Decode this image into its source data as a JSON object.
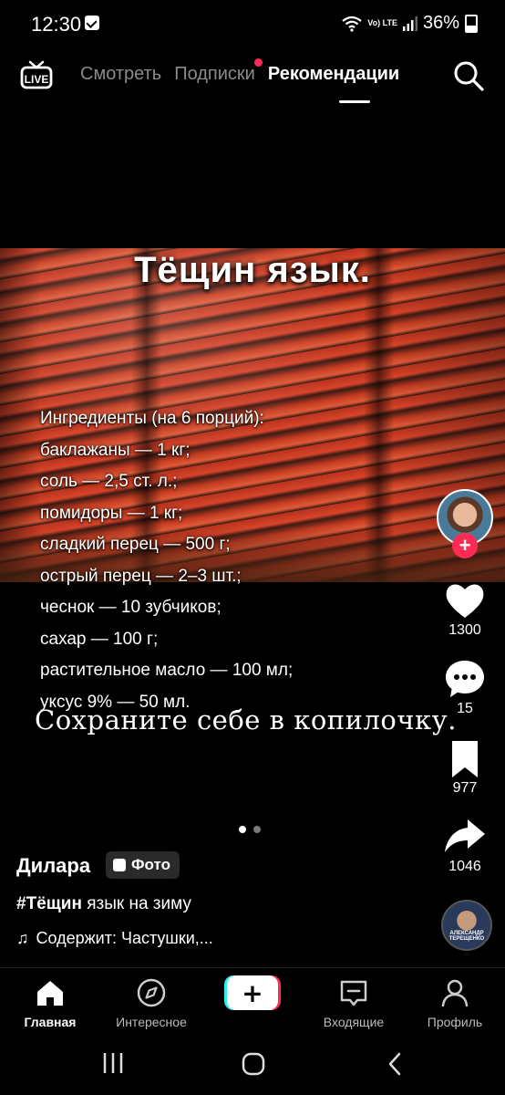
{
  "status_bar": {
    "time": "12:30",
    "network_label": "Vo) LTE",
    "battery": "36%"
  },
  "top_nav": {
    "live_label": "LIVE",
    "tabs": [
      {
        "label": "Смотреть"
      },
      {
        "label": "Подписки"
      },
      {
        "label": "Рекомендации"
      }
    ],
    "active_tab": "Рекомендации"
  },
  "post": {
    "image_title": "Тёщин язык.",
    "ingredients": [
      "Ингредиенты (на 6 порций):",
      "баклажаны — 1 кг;",
      "соль — 2,5 ст. л.;",
      "помидоры — 1 кг;",
      "сладкий перец — 500 г;",
      "острый перец — 2–3 шт.;",
      "чеснок — 10 зубчиков;",
      "сахар — 100 г;",
      "растительное масло — 100 мл;",
      "уксус 9% — 50 мл."
    ],
    "save_note": "Сохраните себе в копилочку.",
    "carousel_count": 2,
    "carousel_active": 0
  },
  "actions": {
    "likes": "1300",
    "comments": "15",
    "bookmarks": "977",
    "shares": "1046",
    "follow_symbol": "+"
  },
  "caption": {
    "author": "Дилара",
    "badge": "Фото",
    "hashtag": "#Тёщин",
    "text": " язык на зиму",
    "music_note": "♫",
    "music": "Содержит: Частушки,..."
  },
  "music_avatar_text": "АЛЕКСАНДР ТЕРЕЩЕНКО",
  "bottom_nav": {
    "home": "Главная",
    "discover": "Интересное",
    "create": "+",
    "inbox": "Входящие",
    "profile": "Профиль"
  },
  "colors": {
    "accent": "#fe2c55",
    "cyan": "#25f4ee",
    "background": "#000000"
  }
}
